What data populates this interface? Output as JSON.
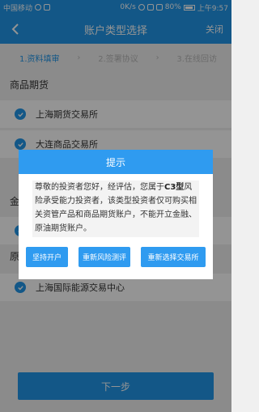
{
  "status_bar": {
    "carrier": "中国移动",
    "speed": "0K/s",
    "battery": "80%",
    "time": "上午9:57"
  },
  "nav": {
    "title": "账户类型选择",
    "close_label": "关闭"
  },
  "steps": [
    {
      "label": "1.资料填审",
      "active": true
    },
    {
      "label": "2.签署协议",
      "active": false
    },
    {
      "label": "3.在线回访",
      "active": false
    }
  ],
  "sections": {
    "commodity_futures": "商品期货",
    "financial_peek": "金",
    "other_peek": "原"
  },
  "options": [
    {
      "label": "上海期货交易所",
      "checked": true
    },
    {
      "label": "大连商品交易所",
      "checked": true
    },
    {
      "label": "",
      "checked": true
    },
    {
      "label": "上海国际能源交易中心",
      "checked": true
    }
  ],
  "next_button": "下一步",
  "dialog": {
    "title": "提示",
    "message_before": "尊敬的投资者您好，经评估，您属于",
    "message_bold": "C3型",
    "message_after": "风险承受能力投资者，该类型投资者仅可购买相关资管产品和商品期货账户，不能开立金融、原油期货账户。",
    "buttons": {
      "continue": "坚持开户",
      "retest": "重新风险测评",
      "reselect": "重新选择交易所"
    }
  },
  "colors": {
    "primary": "#2196e8",
    "dialog_header": "#2f9bf0"
  }
}
